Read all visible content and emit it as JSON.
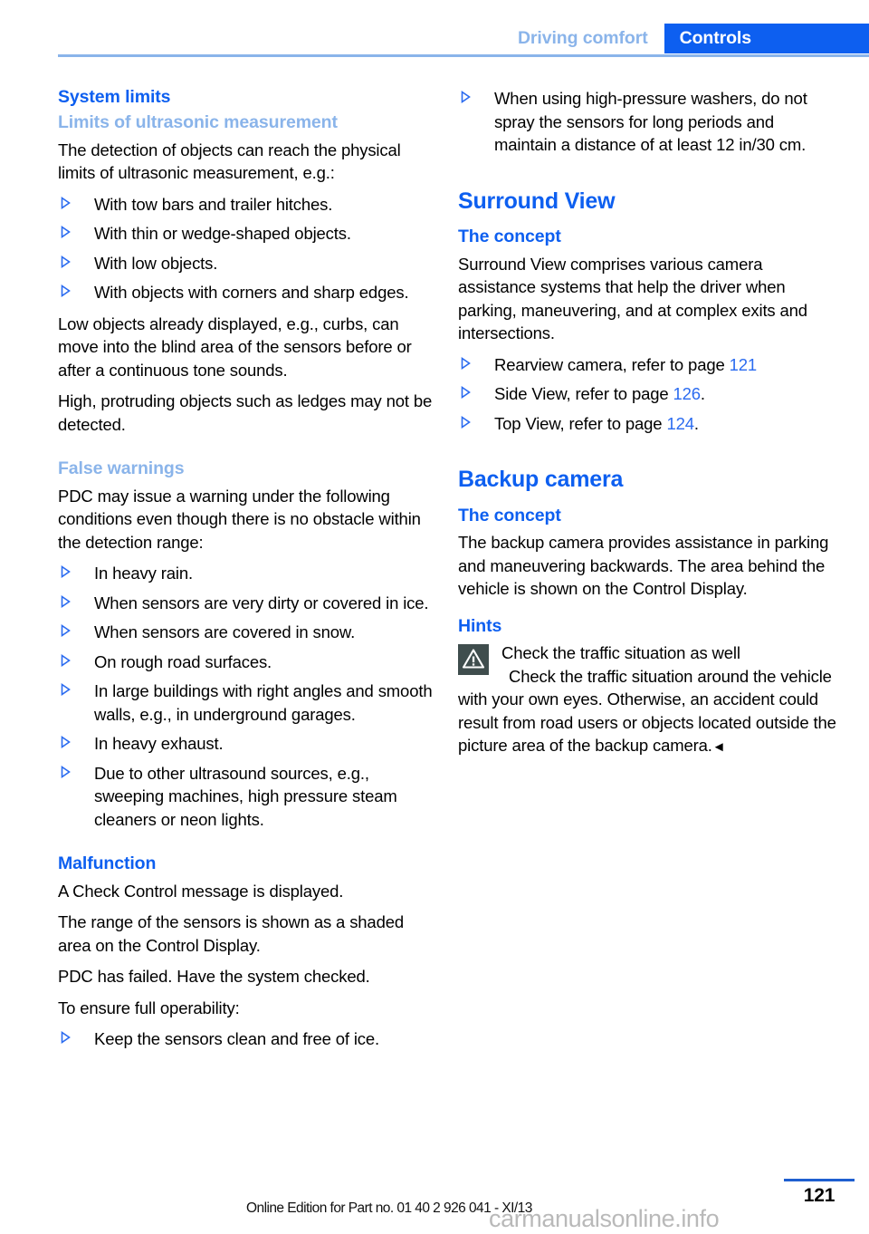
{
  "header": {
    "tab_inactive": "Driving comfort",
    "tab_active": "Controls",
    "accent_blue": "#0d5ff0",
    "light_blue": "#8ab4ea"
  },
  "left_column": {
    "section_title": "System limits",
    "sub1_title": "Limits of ultrasonic measurement",
    "sub1_intro": "The detection of objects can reach the physical limits of ultrasonic measurement, e.g.:",
    "sub1_bullets": [
      "With tow bars and trailer hitches.",
      "With thin or wedge-shaped objects.",
      "With low objects.",
      "With objects with corners and sharp edges."
    ],
    "sub1_para1": "Low objects already displayed, e.g., curbs, can move into the blind area of the sensors before or after a continuous tone sounds.",
    "sub1_para2": "High, protruding objects such as ledges may not be detected.",
    "sub2_title": "False warnings",
    "sub2_intro": "PDC may issue a warning under the following conditions even though there is no obstacle within the detection range:",
    "sub2_bullets": [
      "In heavy rain.",
      "When sensors are very dirty or covered in ice.",
      "When sensors are covered in snow.",
      "On rough road surfaces.",
      "In large buildings with right angles and smooth walls, e.g., in underground garages.",
      "In heavy exhaust.",
      "Due to other ultrasound sources, e.g., sweeping machines, high pressure steam cleaners or neon lights."
    ],
    "sub3_title": "Malfunction",
    "sub3_para1": "A Check Control message is displayed.",
    "sub3_para2": "The range of the sensors is shown as a shaded area on the Control Display.",
    "sub3_para3": "PDC has failed. Have the system checked.",
    "sub3_para4": "To ensure full operability:",
    "sub3_bullets": [
      "Keep the sensors clean and free of ice."
    ]
  },
  "right_column": {
    "continued_bullets": [
      "When using high-pressure washers, do not spray the sensors for long periods and maintain a distance of at least 12 in/30 cm."
    ],
    "surround_view": {
      "title": "Surround View",
      "concept_title": "The concept",
      "concept_para": "Surround View comprises various camera assistance systems that help the driver when parking, maneuvering, and at complex exits and intersections.",
      "refs": [
        {
          "text_before": "Rearview camera, refer to page ",
          "page": "121",
          "text_after": ""
        },
        {
          "text_before": "Side View, refer to page ",
          "page": "126",
          "text_after": "."
        },
        {
          "text_before": "Top View, refer to page ",
          "page": "124",
          "text_after": "."
        }
      ]
    },
    "backup_camera": {
      "title": "Backup camera",
      "concept_title": "The concept",
      "concept_para": "The backup camera provides assistance in parking and maneuvering backwards. The area behind the vehicle is shown on the Control Display.",
      "hints_title": "Hints",
      "warning": {
        "icon": "warning-triangle-icon",
        "headline": "Check the traffic situation as well",
        "body": "Check the traffic situation around the vehicle with your own eyes. Otherwise, an accident could result from road users or objects located outside the picture area of the backup camera.",
        "end_mark": "◄",
        "icon_bg": "#3f4d4d"
      }
    }
  },
  "footer": {
    "edition": "Online Edition for Part no. 01 40 2 926 041 - XI/13",
    "page_number": "121",
    "watermark": "carmanualsonline.info"
  }
}
